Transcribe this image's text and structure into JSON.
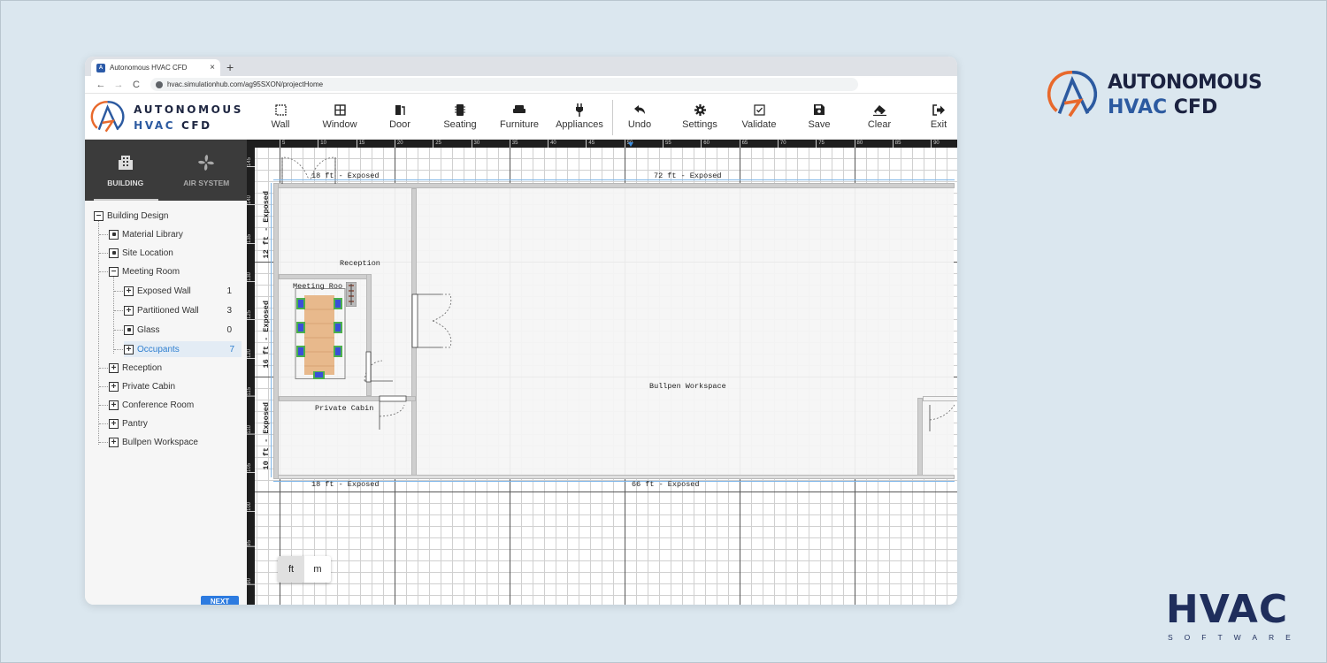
{
  "browser": {
    "tab_title": "Autonomous HVAC CFD",
    "tab_close": "×",
    "new_tab": "+",
    "back": "←",
    "forward": "→",
    "reload": "C",
    "url": "hvac.simulationhub.com/ag95SXON/projectHome"
  },
  "app": {
    "logo_line1": "AUTONOMOUS",
    "logo_line2a": "HVAC ",
    "logo_line2b": "CFD"
  },
  "toolbar": {
    "items": [
      {
        "label": "Wall",
        "icon": "wall-icon"
      },
      {
        "label": "Window",
        "icon": "window-icon"
      },
      {
        "label": "Door",
        "icon": "door-icon"
      },
      {
        "label": "Seating",
        "icon": "seating-icon"
      },
      {
        "label": "Furniture",
        "icon": "sofa-icon"
      },
      {
        "label": "Appliances",
        "icon": "plug-icon"
      },
      {
        "label": "Undo",
        "icon": "undo-icon"
      },
      {
        "label": "Settings",
        "icon": "gear-icon"
      },
      {
        "label": "Validate",
        "icon": "checkbox-icon"
      },
      {
        "label": "Save",
        "icon": "save-icon"
      },
      {
        "label": "Clear",
        "icon": "eraser-icon"
      },
      {
        "label": "Exit",
        "icon": "exit-icon"
      }
    ]
  },
  "sidebar": {
    "tabs": [
      {
        "label": "BUILDING",
        "icon": "building-icon",
        "active": true
      },
      {
        "label": "AIR SYSTEM",
        "icon": "fan-icon",
        "active": false
      }
    ],
    "tree": [
      {
        "label": "Building Design",
        "type": "minus",
        "level": 0
      },
      {
        "label": "Material Library",
        "type": "dot",
        "level": 1
      },
      {
        "label": "Site Location",
        "type": "dot",
        "level": 1
      },
      {
        "label": "Meeting Room",
        "type": "minus",
        "level": 1
      },
      {
        "label": "Exposed Wall",
        "type": "plus",
        "level": 2,
        "count": "1"
      },
      {
        "label": "Partitioned Wall",
        "type": "plus",
        "level": 2,
        "count": "3"
      },
      {
        "label": "Glass",
        "type": "dot",
        "level": 2,
        "count": "0"
      },
      {
        "label": "Occupants",
        "type": "plus",
        "level": 2,
        "count": "7",
        "selected": true
      },
      {
        "label": "Reception",
        "type": "plus",
        "level": 1
      },
      {
        "label": "Private Cabin",
        "type": "plus",
        "level": 1
      },
      {
        "label": "Conference Room",
        "type": "plus",
        "level": 1
      },
      {
        "label": "Pantry",
        "type": "plus",
        "level": 1
      },
      {
        "label": "Bullpen Workspace",
        "type": "plus",
        "level": 1
      }
    ],
    "next_label": "NEXT"
  },
  "canvas": {
    "ruler_top": [
      "5",
      "10",
      "15",
      "20",
      "25",
      "30",
      "35",
      "40",
      "45",
      "50",
      "55",
      "60",
      "65",
      "70",
      "75",
      "80",
      "85",
      "90"
    ],
    "ruler_left": [
      "145",
      "140",
      "135",
      "130",
      "125",
      "120",
      "115",
      "110",
      "105",
      "100",
      "95",
      "90"
    ],
    "dimensions": {
      "top_left": "18 ft - Exposed",
      "top_right": "72 ft - Exposed",
      "bottom_left": "18 ft - Exposed",
      "bottom_right": "66 ft - Exposed",
      "left_top": "12 ft - Exposed",
      "left_mid": "16 ft - Exposed",
      "left_bottom": "10 ft - Exposed"
    },
    "rooms": {
      "reception": "Reception",
      "meeting": "Meeting Roo",
      "private_cabin": "Private Cabin",
      "bullpen": "Bullpen Workspace"
    },
    "units": {
      "ft": "ft",
      "m": "m",
      "active": "ft"
    }
  },
  "branding": {
    "line1": "AUTONOMOUS",
    "line2a": "HVAC ",
    "line2b": "CFD",
    "hvac": "HVAC",
    "software": "SOFTWARE"
  },
  "colors": {
    "accent_orange": "#e8692c",
    "accent_blue": "#2c5aa0",
    "navy": "#1d2540",
    "selection_blue": "#2f7fd0",
    "next_button": "#2d7be0"
  }
}
